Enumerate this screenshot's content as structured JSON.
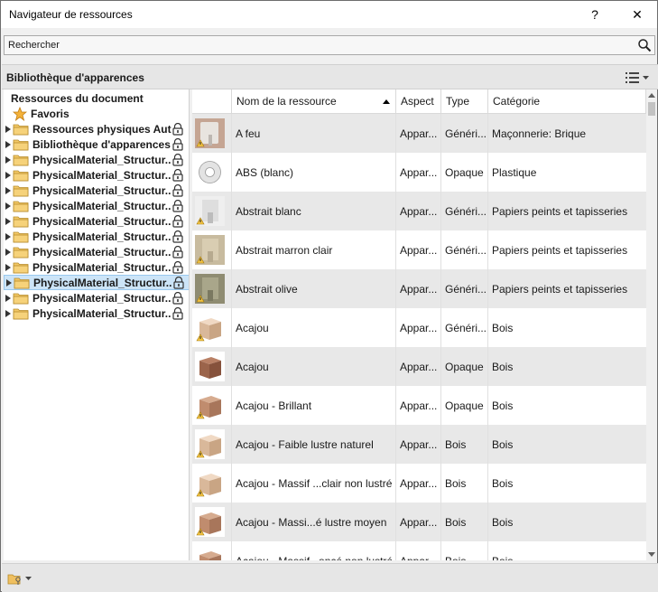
{
  "window": {
    "title": "Navigateur de ressources",
    "help_label": "?",
    "close_label": "✕"
  },
  "search": {
    "placeholder": "Rechercher"
  },
  "library": {
    "title": "Bibliothèque d'apparences"
  },
  "tree": {
    "root_label": "Ressources du document",
    "favorites_label": "Favoris",
    "items": [
      {
        "label": "Ressources physiques Aut...",
        "locked": true
      },
      {
        "label": "Bibliothèque d'apparences",
        "locked": true
      },
      {
        "label": "PhysicalMaterial_Structur...",
        "locked": true
      },
      {
        "label": "PhysicalMaterial_Structur...",
        "locked": true
      },
      {
        "label": "PhysicalMaterial_Structur...",
        "locked": true
      },
      {
        "label": "PhysicalMaterial_Structur...",
        "locked": true
      },
      {
        "label": "PhysicalMaterial_Structur...",
        "locked": true
      },
      {
        "label": "PhysicalMaterial_Structur...",
        "locked": true
      },
      {
        "label": "PhysicalMaterial_Structur...",
        "locked": true
      },
      {
        "label": "PhysicalMaterial_Structur...",
        "locked": true
      },
      {
        "label": "PhysicalMaterial_Structur...",
        "locked": true
      },
      {
        "label": "PhysicalMaterial_Structur...",
        "locked": true
      },
      {
        "label": "PhysicalMaterial_Structur...",
        "locked": true
      }
    ],
    "selected_index": 10
  },
  "table": {
    "columns": [
      "",
      "Nom de la ressource",
      "Aspect",
      "Type",
      "Catégorie"
    ],
    "rows": [
      {
        "name": "A feu",
        "aspect": "Appar...",
        "type": "Généri...",
        "category": "Maçonnerie: Brique",
        "thumb": "sink"
      },
      {
        "name": "ABS (blanc)",
        "aspect": "Appar...",
        "type": "Opaque",
        "category": "Plastique",
        "thumb": "ring"
      },
      {
        "name": "Abstrait blanc",
        "aspect": "Appar...",
        "type": "Généri...",
        "category": "Papiers peints et tapisseries",
        "thumb": "wall-white"
      },
      {
        "name": "Abstrait marron clair",
        "aspect": "Appar...",
        "type": "Généri...",
        "category": "Papiers peints et tapisseries",
        "thumb": "wall-tan"
      },
      {
        "name": "Abstrait olive",
        "aspect": "Appar...",
        "type": "Généri...",
        "category": "Papiers peints et tapisseries",
        "thumb": "wall-olive"
      },
      {
        "name": "Acajou",
        "aspect": "Appar...",
        "type": "Généri...",
        "category": "Bois",
        "thumb": "cube-light"
      },
      {
        "name": "Acajou",
        "aspect": "Appar...",
        "type": "Opaque",
        "category": "Bois",
        "thumb": "cube-dark"
      },
      {
        "name": "Acajou - Brillant",
        "aspect": "Appar...",
        "type": "Opaque",
        "category": "Bois",
        "thumb": "cube-mid"
      },
      {
        "name": "Acajou - Faible lustre naturel",
        "aspect": "Appar...",
        "type": "Bois",
        "category": "Bois",
        "thumb": "cube-light"
      },
      {
        "name": "Acajou - Massif ...clair non lustré",
        "aspect": "Appar...",
        "type": "Bois",
        "category": "Bois",
        "thumb": "cube-light"
      },
      {
        "name": "Acajou - Massi...é lustre moyen",
        "aspect": "Appar...",
        "type": "Bois",
        "category": "Bois",
        "thumb": "cube-mid"
      },
      {
        "name": "Acajou - Massif...oncé non lustré",
        "aspect": "Appar...",
        "type": "Bois",
        "category": "Bois",
        "thumb": "cube-mid"
      }
    ]
  }
}
